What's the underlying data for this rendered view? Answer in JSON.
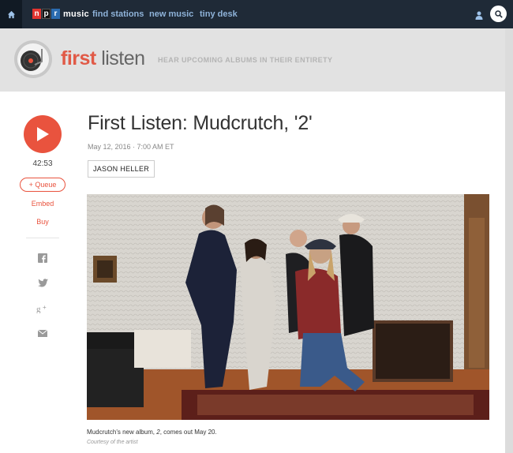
{
  "topnav": {
    "logo_letters": [
      "n",
      "p",
      "r"
    ],
    "logo_colors": [
      "#e3342f",
      "#111111",
      "#2b6cb0"
    ],
    "logo_word": "music",
    "links": [
      "find stations",
      "new music",
      "tiny desk"
    ],
    "icons": [
      "home-icon",
      "user-icon",
      "search-icon"
    ]
  },
  "banner": {
    "title_bold": "first",
    "title_light": "listen",
    "tagline": "HEAR UPCOMING ALBUMS IN THEIR ENTIRETY",
    "icon": "record-player-icon"
  },
  "player": {
    "duration": "42:53",
    "queue_label": "+ Queue",
    "embed_label": "Embed",
    "buy_label": "Buy",
    "share_icons": [
      "facebook-icon",
      "twitter-icon",
      "google-plus-icon",
      "email-icon"
    ]
  },
  "article": {
    "headline": "First Listen: Mudcrutch, '2'",
    "dateline": "May 12, 2016 · 7:00 AM ET",
    "author": "JASON HELLER",
    "caption_parts": [
      "Mudcrutch's new album, ",
      "2",
      ", comes out May 20."
    ],
    "credit": "Courtesy of the artist"
  },
  "colors": {
    "accent": "#e9533e",
    "nav_bg": "#1f2a37",
    "nav_link": "#8fb3d9"
  }
}
